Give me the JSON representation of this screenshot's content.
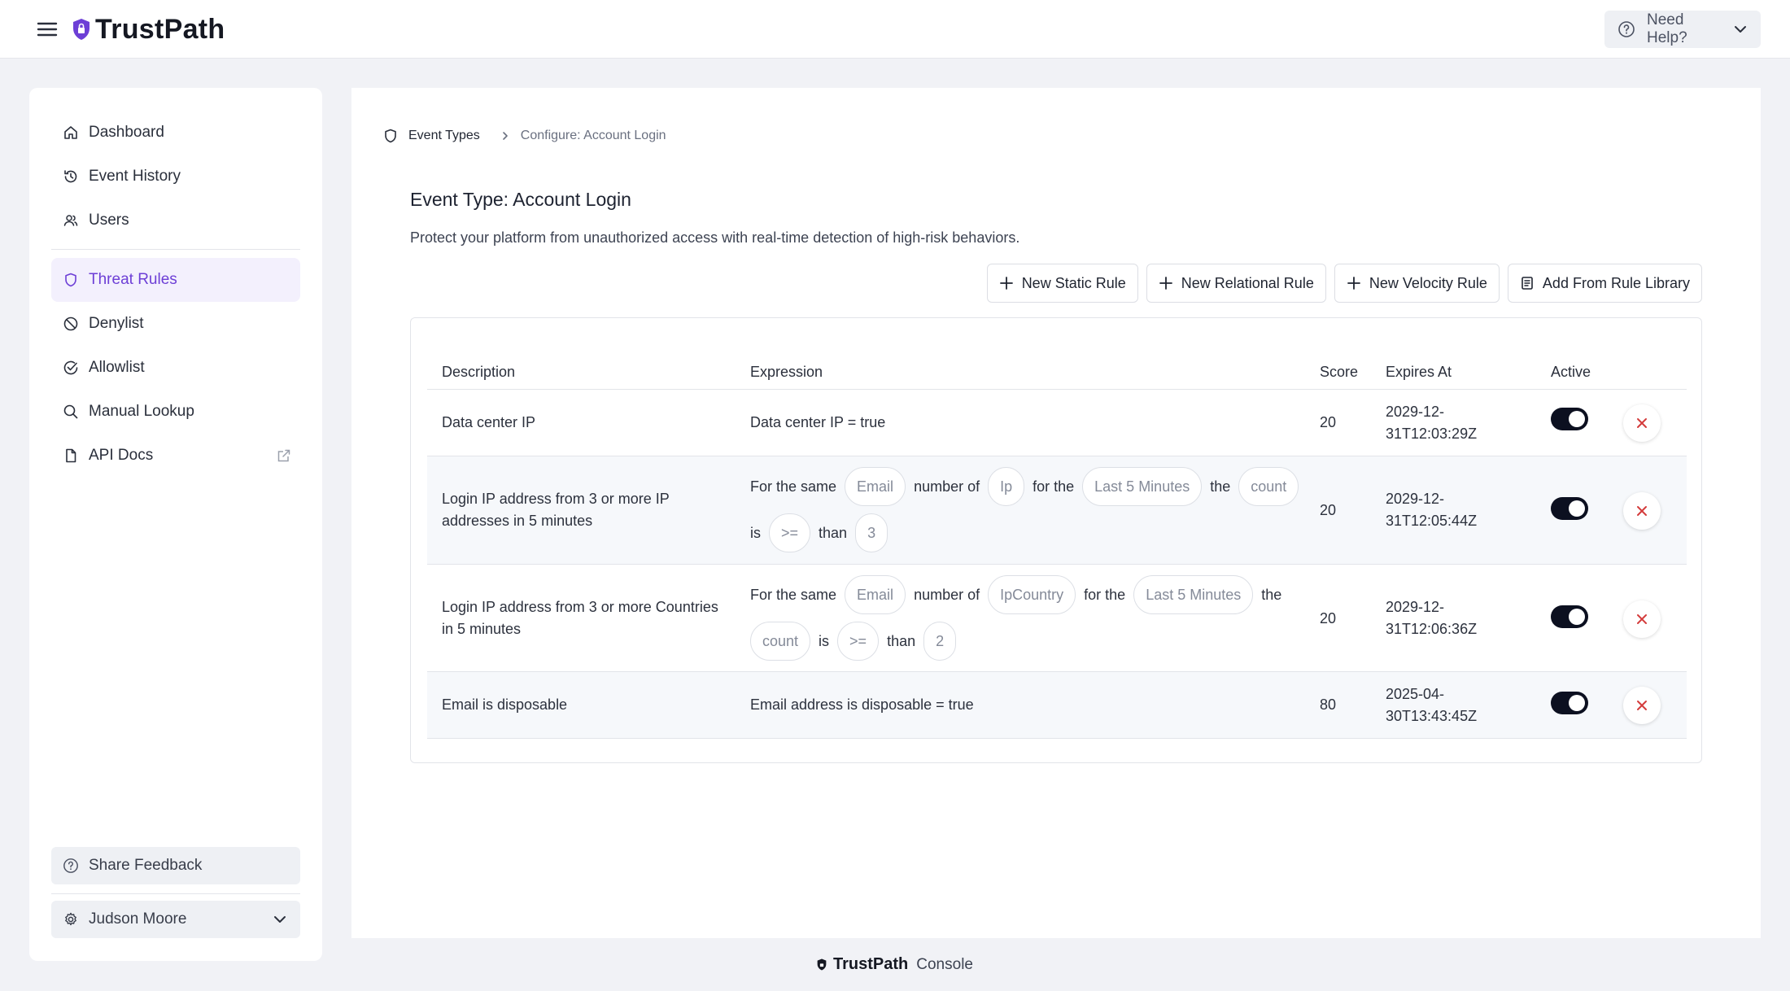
{
  "app": {
    "name": "TrustPath",
    "brand_color": "#6d3fd6"
  },
  "header": {
    "help_label": "Need Help?",
    "help_icon": "help-circle-icon",
    "menu_icon": "hamburger-icon"
  },
  "sidebar": {
    "items": [
      {
        "label": "Dashboard",
        "icon": "home-icon",
        "active": false
      },
      {
        "label": "Event History",
        "icon": "history-icon",
        "active": false
      },
      {
        "label": "Users",
        "icon": "users-icon",
        "active": false
      },
      {
        "label": "Threat Rules",
        "icon": "shield-icon",
        "active": true
      },
      {
        "label": "Denylist",
        "icon": "ban-icon",
        "active": false
      },
      {
        "label": "Allowlist",
        "icon": "check-circle-icon",
        "active": false
      },
      {
        "label": "Manual Lookup",
        "icon": "search-icon",
        "active": false
      },
      {
        "label": "API Docs",
        "icon": "document-icon",
        "active": false
      }
    ],
    "share_feedback": "Share Feedback",
    "user_name": "Judson Moore"
  },
  "breadcrumb": {
    "parent": "Event Types",
    "current": "Configure: Account Login"
  },
  "page": {
    "title": "Event Type: Account Login",
    "description": "Protect your platform from unauthorized access with real-time detection of high-risk behaviors."
  },
  "actions": {
    "new_static": "New Static Rule",
    "new_relational": "New Relational Rule",
    "new_velocity": "New Velocity Rule",
    "add_library": "Add From Rule Library"
  },
  "table": {
    "headers": {
      "description": "Description",
      "expression": "Expression",
      "score": "Score",
      "expires": "Expires At",
      "active": "Active"
    },
    "rows": [
      {
        "description": "Data center IP",
        "expression": "Data center IP = true",
        "score": "20",
        "expires_l1": "2029-12-",
        "expires_l2": "31T12:03:29Z",
        "active": true
      },
      {
        "description": "Login IP address from 3 or more IP addresses in 5 minutes",
        "expr": {
          "t1": "For the same",
          "p1": "Email",
          "t2": "number of",
          "p2": "Ip",
          "t3": "for the",
          "p3": "Last 5 Minutes",
          "t4": "the",
          "p4": "count",
          "t5": "is",
          "p5": ">=",
          "t6": "than",
          "p6": "3"
        },
        "score": "20",
        "expires_l1": "2029-12-",
        "expires_l2": "31T12:05:44Z",
        "active": true
      },
      {
        "description": "Login IP address from 3 or more Countries in 5 minutes",
        "expr": {
          "t1": "For the same",
          "p1": "Email",
          "t2": "number of",
          "p2": "IpCountry",
          "t3": "for the",
          "p3": "Last 5 Minutes",
          "t4": "the",
          "p4": "count",
          "t5": "is",
          "p5": ">=",
          "t6": "than",
          "p6": "2"
        },
        "score": "20",
        "expires_l1": "2029-12-",
        "expires_l2": "31T12:06:36Z",
        "active": true
      },
      {
        "description": "Email is disposable",
        "expression": "Email address is disposable = true",
        "score": "80",
        "expires_l1": "2025-04-",
        "expires_l2": "30T13:43:45Z",
        "active": true
      }
    ]
  },
  "footer": {
    "brand": "TrustPath",
    "suffix": "Console"
  }
}
